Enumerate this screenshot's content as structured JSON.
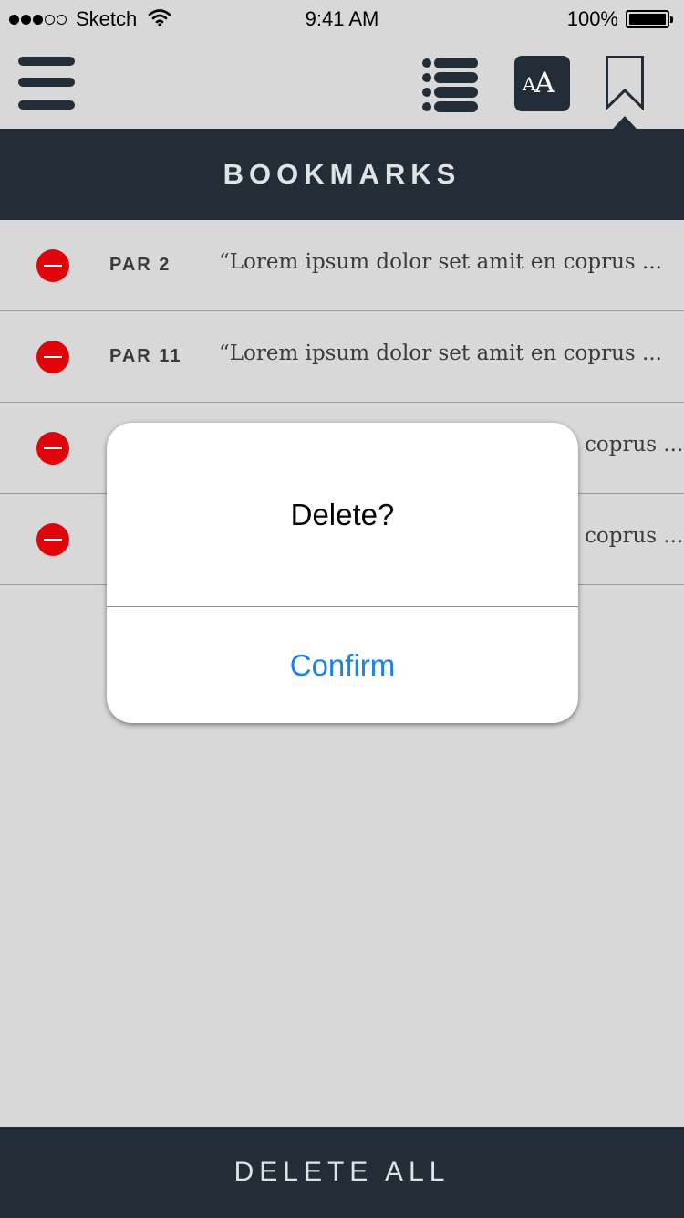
{
  "status_bar": {
    "carrier": "Sketch",
    "time": "9:41 AM",
    "battery_percent": "100%",
    "signal_bars_filled": 3,
    "signal_bars_total": 5
  },
  "toolbar": {
    "menu_icon": "hamburger-menu-icon",
    "list_icon": "list-icon",
    "font_icon": "font-size-icon",
    "font_small_label": "A",
    "font_large_label": "A",
    "bookmark_icon": "bookmark-icon"
  },
  "header": {
    "title": "BOOKMARKS"
  },
  "bookmarks": [
    {
      "label": "PAR 2",
      "excerpt": "“Lorem ipsum dolor set amit en coprus ..."
    },
    {
      "label": "PAR 11",
      "excerpt": "“Lorem ipsum dolor set amit en coprus ..."
    },
    {
      "label": "",
      "excerpt": "coprus ..."
    },
    {
      "label": "",
      "excerpt": "coprus ..."
    }
  ],
  "dialog": {
    "title": "Delete?",
    "confirm_label": "Confirm"
  },
  "footer": {
    "delete_all_label": "DELETE ALL"
  },
  "colors": {
    "background": "#d8d8d8",
    "navy": "#222d38",
    "delete_red": "#e0040b",
    "confirm_blue": "#1a82e8"
  }
}
